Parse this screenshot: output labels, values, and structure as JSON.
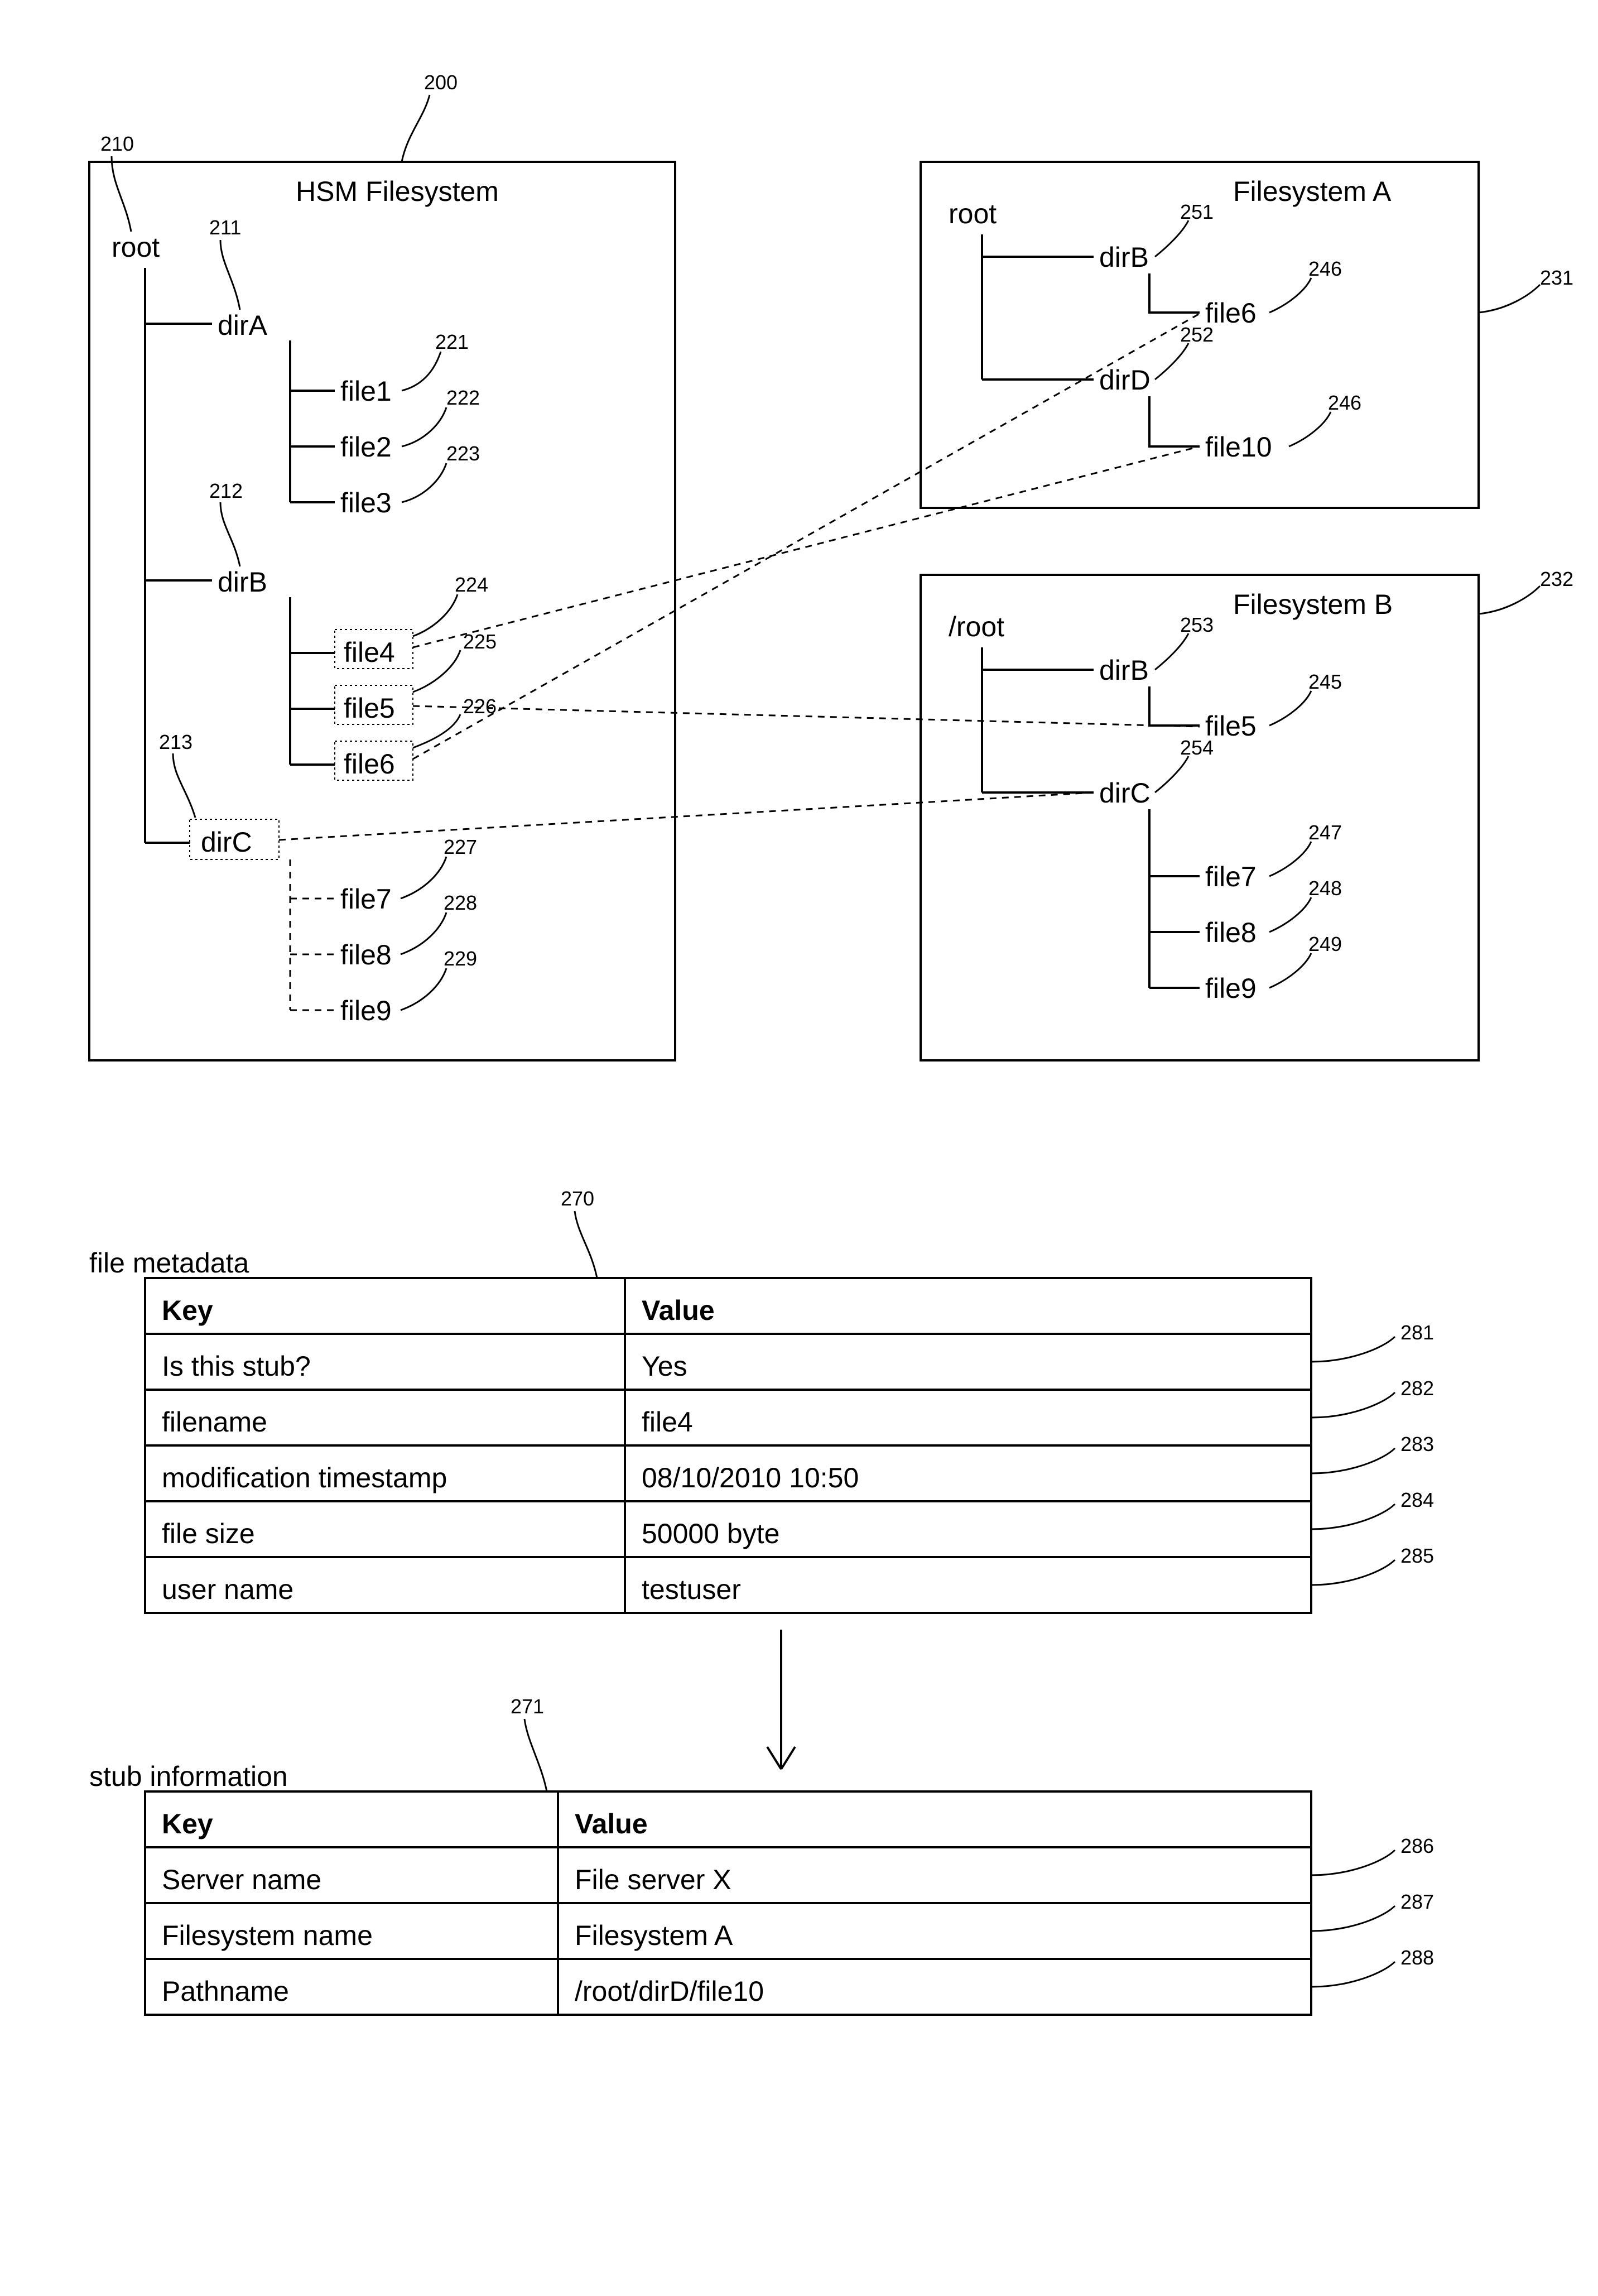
{
  "hsm": {
    "title": "HSM Filesystem",
    "root": "root",
    "dirA": "dirA",
    "dirB": "dirB",
    "dirC": "dirC",
    "f1": "file1",
    "f2": "file2",
    "f3": "file3",
    "f4": "file4",
    "f5": "file5",
    "f6": "file6",
    "f7": "file7",
    "f8": "file8",
    "f9": "file9"
  },
  "fsA": {
    "title": "Filesystem A",
    "root": "root",
    "dirB": "dirB",
    "dirD": "dirD",
    "f6": "file6",
    "f10": "file10"
  },
  "fsB": {
    "title": "Filesystem B",
    "root": "/root",
    "dirB": "dirB",
    "dirC": "dirC",
    "f5": "file5",
    "f7": "file7",
    "f8": "file8",
    "f9": "file9"
  },
  "refs": {
    "r200": "200",
    "r210": "210",
    "r211": "211",
    "r212": "212",
    "r213": "213",
    "r221": "221",
    "r222": "222",
    "r223": "223",
    "r224": "224",
    "r225": "225",
    "r226": "226",
    "r227": "227",
    "r228": "228",
    "r229": "229",
    "r231": "231",
    "r232": "232",
    "r245": "245",
    "r246a": "246",
    "r246b": "246",
    "r247": "247",
    "r248": "248",
    "r249": "249",
    "r251": "251",
    "r252": "252",
    "r253": "253",
    "r254": "254",
    "r270": "270",
    "r271": "271",
    "r281": "281",
    "r282": "282",
    "r283": "283",
    "r284": "284",
    "r285": "285",
    "r286": "286",
    "r287": "287",
    "r288": "288"
  },
  "meta": {
    "label": "file metadata",
    "headerKey": "Key",
    "headerVal": "Value",
    "rows": [
      {
        "k": "Is this stub?",
        "v": "Yes"
      },
      {
        "k": "filename",
        "v": "file4"
      },
      {
        "k": "modification timestamp",
        "v": "08/10/2010 10:50"
      },
      {
        "k": "file size",
        "v": "50000 byte"
      },
      {
        "k": "user name",
        "v": "testuser"
      }
    ]
  },
  "stub": {
    "label": "stub information",
    "headerKey": "Key",
    "headerVal": "Value",
    "rows": [
      {
        "k": "Server name",
        "v": "File server X"
      },
      {
        "k": "Filesystem name",
        "v": "Filesystem A"
      },
      {
        "k": "Pathname",
        "v": "/root/dirD/file10"
      }
    ]
  }
}
